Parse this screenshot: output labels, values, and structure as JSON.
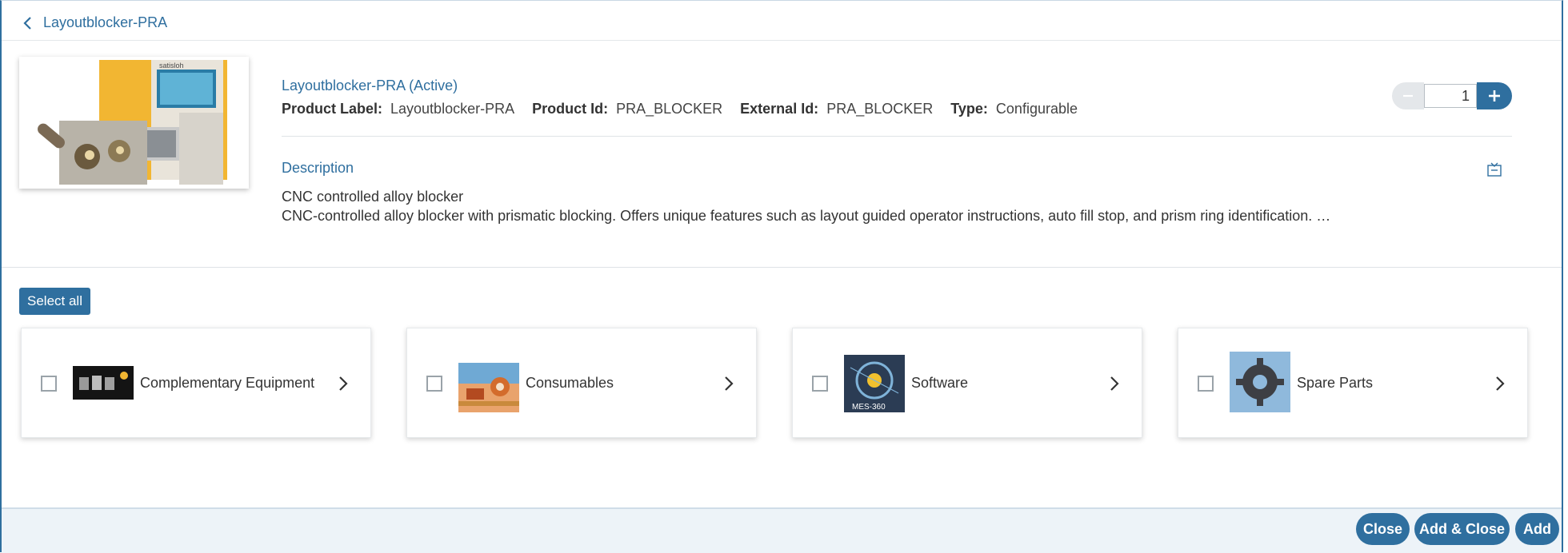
{
  "header": {
    "back_title": "Layoutblocker-PRA"
  },
  "product": {
    "name_status": "Layoutblocker-PRA (Active)",
    "fields": [
      {
        "key": "Product Label:",
        "value": "Layoutblocker-PRA"
      },
      {
        "key": "Product Id:",
        "value": "PRA_BLOCKER"
      },
      {
        "key": "External Id:",
        "value": "PRA_BLOCKER"
      },
      {
        "key": "Type:",
        "value": "Configurable"
      }
    ],
    "quantity": "1",
    "image_brand_text": "satisloh"
  },
  "description": {
    "heading": "Description",
    "line1": "CNC controlled alloy blocker",
    "line2": "CNC-controlled alloy blocker with prismatic blocking. Offers unique features such as layout guided operator instructions, auto fill stop, and prism ring identification. …"
  },
  "select_all_label": "Select all",
  "categories": [
    {
      "label": "Complementary Equipment",
      "icon": "equipment-thumbnail"
    },
    {
      "label": "Consumables",
      "icon": "consumables-thumbnail"
    },
    {
      "label": "Software",
      "icon": "software-thumbnail",
      "thumb_text": "MES-360"
    },
    {
      "label": "Spare Parts",
      "icon": "spare-parts-thumbnail"
    }
  ],
  "footer": {
    "close": "Close",
    "add_close": "Add & Close",
    "add": "Add"
  },
  "colors": {
    "accent": "#2f6f9f",
    "footer_bg": "#edf3f8"
  }
}
